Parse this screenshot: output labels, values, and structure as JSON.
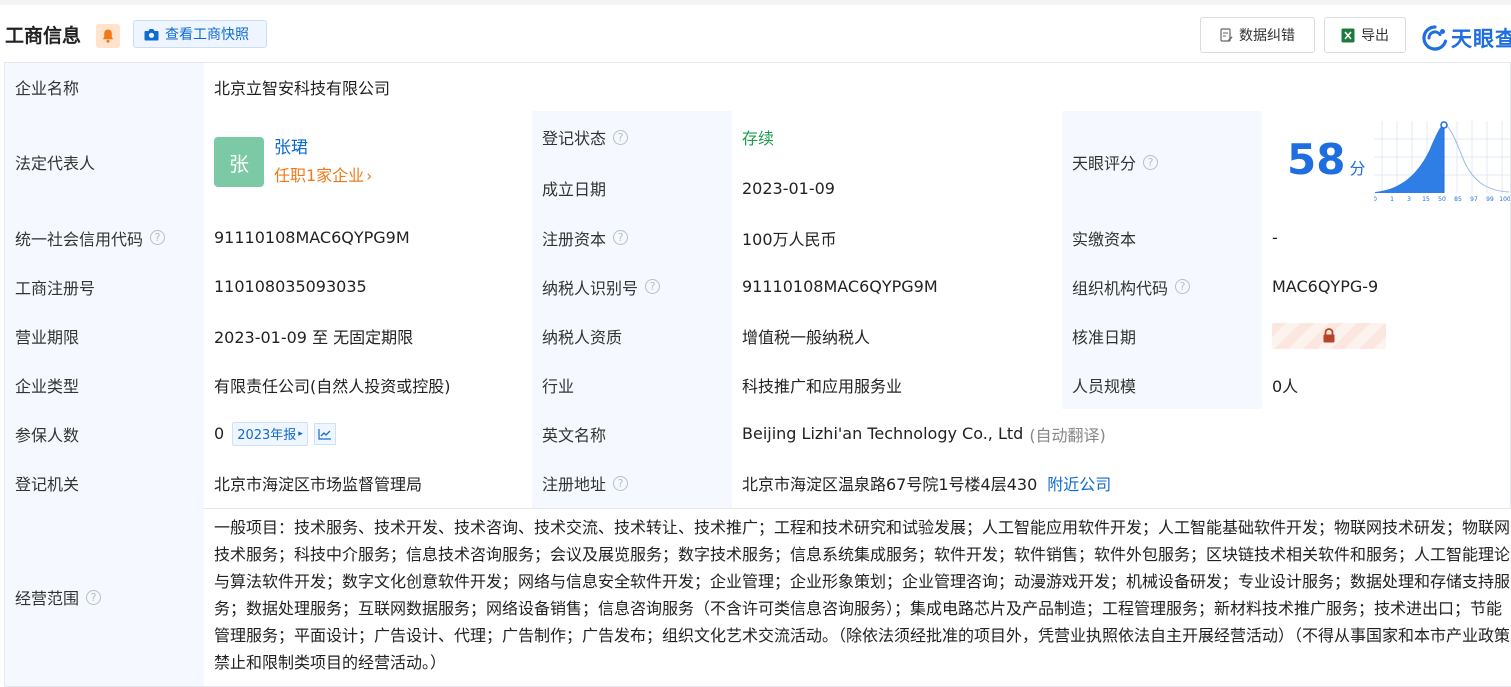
{
  "header": {
    "title": "工商信息",
    "snapshot_label": "查看工商快照",
    "correction_label": "数据纠错",
    "export_label": "导出",
    "logo_text": "天眼查"
  },
  "company": {
    "name_label": "企业名称",
    "name": "北京立智安科技有限公司",
    "legal_rep_label": "法定代表人",
    "legal_rep_avatar": "张",
    "legal_rep_name": "张珺",
    "legal_rep_positions": "任职1家企业",
    "reg_status_label": "登记状态",
    "reg_status": "存续",
    "founded_label": "成立日期",
    "founded": "2023-01-09",
    "score_label": "天眼评分",
    "score": "58",
    "score_unit": "分",
    "score_axis": [
      "0",
      "1",
      "3",
      "15",
      "50",
      "85",
      "97",
      "99",
      "100"
    ],
    "credit_code_label": "统一社会信用代码",
    "credit_code": "91110108MAC6QYPG9M",
    "reg_capital_label": "注册资本",
    "reg_capital": "100万人民币",
    "paid_capital_label": "实缴资本",
    "paid_capital": "-",
    "reg_no_label": "工商注册号",
    "reg_no": "110108035093035",
    "taxpayer_id_label": "纳税人识别号",
    "taxpayer_id": "91110108MAC6QYPG9M",
    "org_code_label": "组织机构代码",
    "org_code": "MAC6QYPG-9",
    "term_label": "营业期限",
    "term": "2023-01-09 至 无固定期限",
    "taxpayer_qual_label": "纳税人资质",
    "taxpayer_qual": "增值税一般纳税人",
    "approval_label": "核准日期",
    "type_label": "企业类型",
    "type": "有限责任公司(自然人投资或控股)",
    "industry_label": "行业",
    "industry": "科技推广和应用服务业",
    "staff_label": "人员规模",
    "staff": "0人",
    "insured_label": "参保人数",
    "insured": "0",
    "insured_report": "2023年报",
    "english_name_label": "英文名称",
    "english_name": "Beijing Lizhi'an Technology Co., Ltd",
    "english_note": "(自动翻译)",
    "authority_label": "登记机关",
    "authority": "北京市海淀区市场监督管理局",
    "address_label": "注册地址",
    "address": "北京市海淀区温泉路67号院1号楼4层430",
    "nearby": "附近公司",
    "scope_label": "经营范围",
    "scope": "一般项目：技术服务、技术开发、技术咨询、技术交流、技术转让、技术推广；工程和技术研究和试验发展；人工智能应用软件开发；人工智能基础软件开发；物联网技术研发；物联网技术服务；科技中介服务；信息技术咨询服务；会议及展览服务；数字技术服务；信息系统集成服务；软件开发；软件销售；软件外包服务；区块链技术相关软件和服务；人工智能理论与算法软件开发；数字文化创意软件开发；网络与信息安全软件开发；企业管理；企业形象策划；企业管理咨询；动漫游戏开发；机械设备研发；专业设计服务；数据处理和存储支持服务；数据处理服务；互联网数据服务；网络设备销售；信息咨询服务（不含许可类信息咨询服务）；集成电路芯片及产品制造；工程管理服务；新材料技术推广服务；技术进出口；节能管理服务；平面设计；广告设计、代理；广告制作；广告发布；组织文化艺术交流活动。（除依法须经批准的项目外，凭营业执照依法自主开展经营活动）（不得从事国家和本市产业政策禁止和限制类项目的经营活动。）"
  },
  "colors": {
    "accent": "#0f6bd0",
    "status_green": "#1a9e4a",
    "orange": "#f07a1a",
    "label_bg": "#f5f8fe",
    "avatar": "#7ccaa5",
    "lock": "#b5442a"
  }
}
